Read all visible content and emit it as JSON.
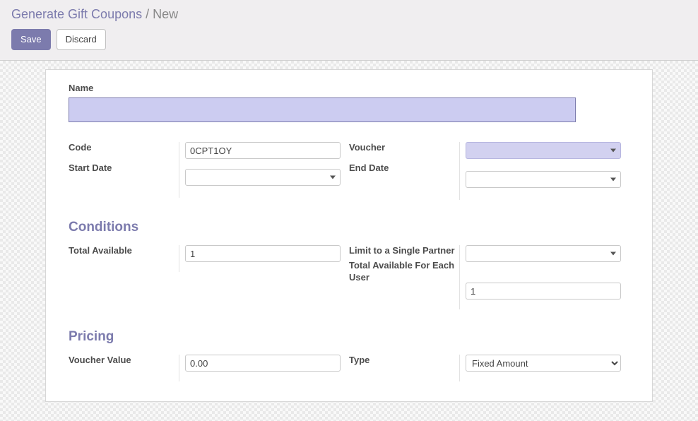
{
  "header": {
    "breadcrumb_root": "Generate Gift Coupons",
    "breadcrumb_sep": "/",
    "breadcrumb_current": "New",
    "save_label": "Save",
    "discard_label": "Discard"
  },
  "basic": {
    "name_label": "Name",
    "name_value": "",
    "code_label": "Code",
    "code_value": "0CPT1OY",
    "start_date_label": "Start Date",
    "start_date_value": "",
    "voucher_label": "Voucher",
    "voucher_value": "",
    "end_date_label": "End Date",
    "end_date_value": ""
  },
  "conditions": {
    "title": "Conditions",
    "total_available_label": "Total Available",
    "total_available_value": "1",
    "limit_partner_label": "Limit to a Single Partner",
    "limit_partner_value": "",
    "total_each_user_label": "Total Available For Each User",
    "total_each_user_value": "1"
  },
  "pricing": {
    "title": "Pricing",
    "voucher_value_label": "Voucher Value",
    "voucher_value_value": "0.00",
    "type_label": "Type",
    "type_value": "Fixed Amount"
  }
}
